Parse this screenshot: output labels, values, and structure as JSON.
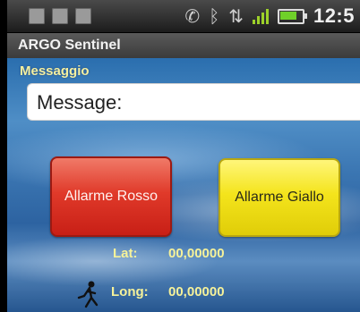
{
  "status_bar": {
    "left_icons": [
      "facebook-icon",
      "facebook-icon",
      "notification-icon"
    ],
    "right_icons": [
      "phone-icon",
      "bluetooth-icon",
      "network-icon",
      "signal-icon",
      "battery-icon"
    ],
    "time": "12:5",
    "signal_color": "#9dd12a",
    "battery_color": "#6fd12a"
  },
  "app": {
    "title": "ARGO Sentinel"
  },
  "message": {
    "label": "Messaggio",
    "placeholder": "Message:"
  },
  "buttons": {
    "red_label": "Allarme Rosso",
    "yellow_label": "Allarme Giallo",
    "red_color": "#e03a2a",
    "yellow_color": "#f4e41c"
  },
  "coords": {
    "lat_label": "Lat:",
    "lat_value": "00,00000",
    "long_label": "Long:",
    "long_value": "00,00000"
  }
}
